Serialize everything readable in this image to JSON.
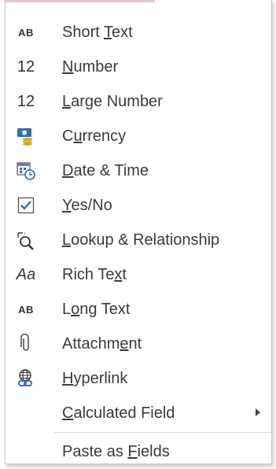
{
  "menu": {
    "items": [
      {
        "icon": "short-text-icon",
        "icon_text": "AB",
        "pre": "Short ",
        "key": "T",
        "post": "ext"
      },
      {
        "icon": "number-icon",
        "icon_text": "12",
        "pre": "",
        "key": "N",
        "post": "umber"
      },
      {
        "icon": "large-number-icon",
        "icon_text": "12",
        "pre": "",
        "key": "L",
        "post": "arge Number"
      },
      {
        "icon": "currency-icon",
        "icon_text": "",
        "pre": "C",
        "key": "u",
        "post": "rrency"
      },
      {
        "icon": "date-time-icon",
        "icon_text": "",
        "pre": "",
        "key": "D",
        "post": "ate & Time"
      },
      {
        "icon": "yes-no-checkbox-icon",
        "icon_text": "",
        "pre": "",
        "key": "Y",
        "post": "es/No"
      },
      {
        "icon": "lookup-relationship-icon",
        "icon_text": "",
        "pre": "",
        "key": "L",
        "post": "ookup & Relationship"
      },
      {
        "icon": "rich-text-icon",
        "icon_text": "Aa",
        "pre": "Rich Te",
        "key": "x",
        "post": "t"
      },
      {
        "icon": "long-text-icon",
        "icon_text": "AB",
        "pre": "L",
        "key": "o",
        "post": "ng Text"
      },
      {
        "icon": "attachment-paperclip-icon",
        "icon_text": "",
        "pre": "Attachm",
        "key": "e",
        "post": "nt"
      },
      {
        "icon": "hyperlink-icon",
        "icon_text": "",
        "pre": "",
        "key": "H",
        "post": "yperlink"
      },
      {
        "icon": "",
        "icon_text": "",
        "pre": "",
        "key": "C",
        "post": "alculated Field"
      },
      {
        "icon": "",
        "icon_text": "",
        "pre": "Paste as ",
        "key": "F",
        "post": "ields"
      }
    ]
  },
  "colors": {
    "text": "#3a3a3a",
    "icon_blue": "#2b6fb6",
    "icon_gold": "#d9a520",
    "border": "#c9c9c9"
  }
}
